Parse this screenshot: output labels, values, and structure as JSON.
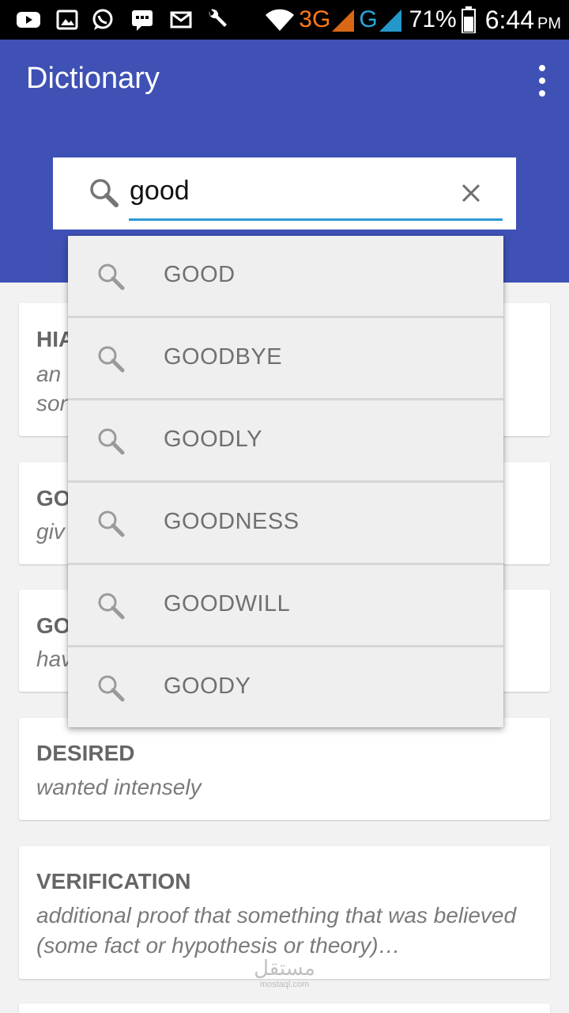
{
  "status_bar": {
    "network_3g": "3G",
    "network_g": "G",
    "battery_percent": "71%",
    "time": "6:44",
    "time_suffix": "PM",
    "icons": [
      "youtube-icon",
      "gallery-icon",
      "whatsapp-icon",
      "message-icon",
      "mail-icon",
      "wrench-icon",
      "wifi-icon",
      "signal-icon",
      "battery-icon"
    ],
    "accent_3g": "#ff7a1a",
    "accent_g": "#2aa7e0"
  },
  "app_bar": {
    "title": "Dictionary",
    "color": "#3f51b5",
    "menu_icon": "overflow-menu-icon"
  },
  "search": {
    "value": "good",
    "search_icon": "search-icon",
    "clear_icon": "close-icon",
    "underline_color": "#2c9ad6"
  },
  "suggestions": [
    {
      "label": "GOOD"
    },
    {
      "label": "GOODBYE"
    },
    {
      "label": "GOODLY"
    },
    {
      "label": "GOODNESS"
    },
    {
      "label": "GOODWILL"
    },
    {
      "label": "GOODY"
    }
  ],
  "cards": [
    {
      "word": "HIA",
      "definition": "an",
      "definition_2": "sor"
    },
    {
      "word": "GO",
      "definition": "giv"
    },
    {
      "word": "GO",
      "definition": "hav"
    },
    {
      "word": "DESIRED",
      "definition": "wanted intensely"
    },
    {
      "word": "VERIFICATION",
      "definition": "additional proof that something that was believed (some fact or hypothesis or theory)…"
    }
  ],
  "watermark": {
    "arabic": "مستقل",
    "latin": "mostaql.com"
  }
}
